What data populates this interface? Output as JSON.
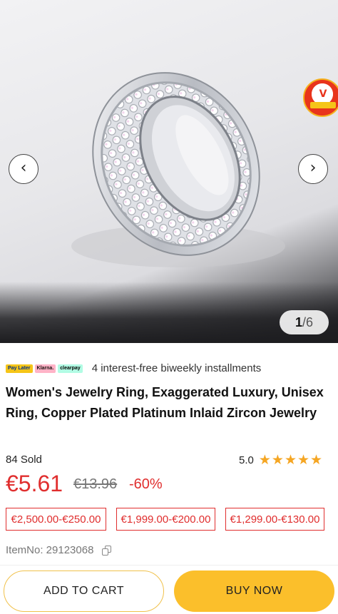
{
  "gallery": {
    "current": "1",
    "separator": "/",
    "total": "6",
    "prev_icon": "chevron-left-icon",
    "next_icon": "chevron-right-icon",
    "seal_mark": "V"
  },
  "payment": {
    "badges": [
      "Pay Later",
      "Klarna.",
      "clearpay"
    ],
    "text": "4 interest-free biweekly installments"
  },
  "product": {
    "title": "Women's Jewelry Ring, Exaggerated Luxury, Unisex Ring, Copper Plated Platinum Inlaid Zircon Jewelry",
    "sold": "84 Sold",
    "rating": "5.0",
    "stars": 5,
    "price": "€5.61",
    "original_price": "€13.96",
    "discount": "-60%",
    "tiers": [
      "€2,500.00-€250.00",
      "€1,999.00-€200.00",
      "€1,299.00-€130.00"
    ],
    "item_no": "ItemNo: 29123068"
  },
  "actions": {
    "add_to_cart": "ADD TO CART",
    "buy_now": "BUY NOW"
  },
  "colors": {
    "price": "#e02e2e",
    "buy_button": "#fbbf2b",
    "star": "#f5a623"
  }
}
